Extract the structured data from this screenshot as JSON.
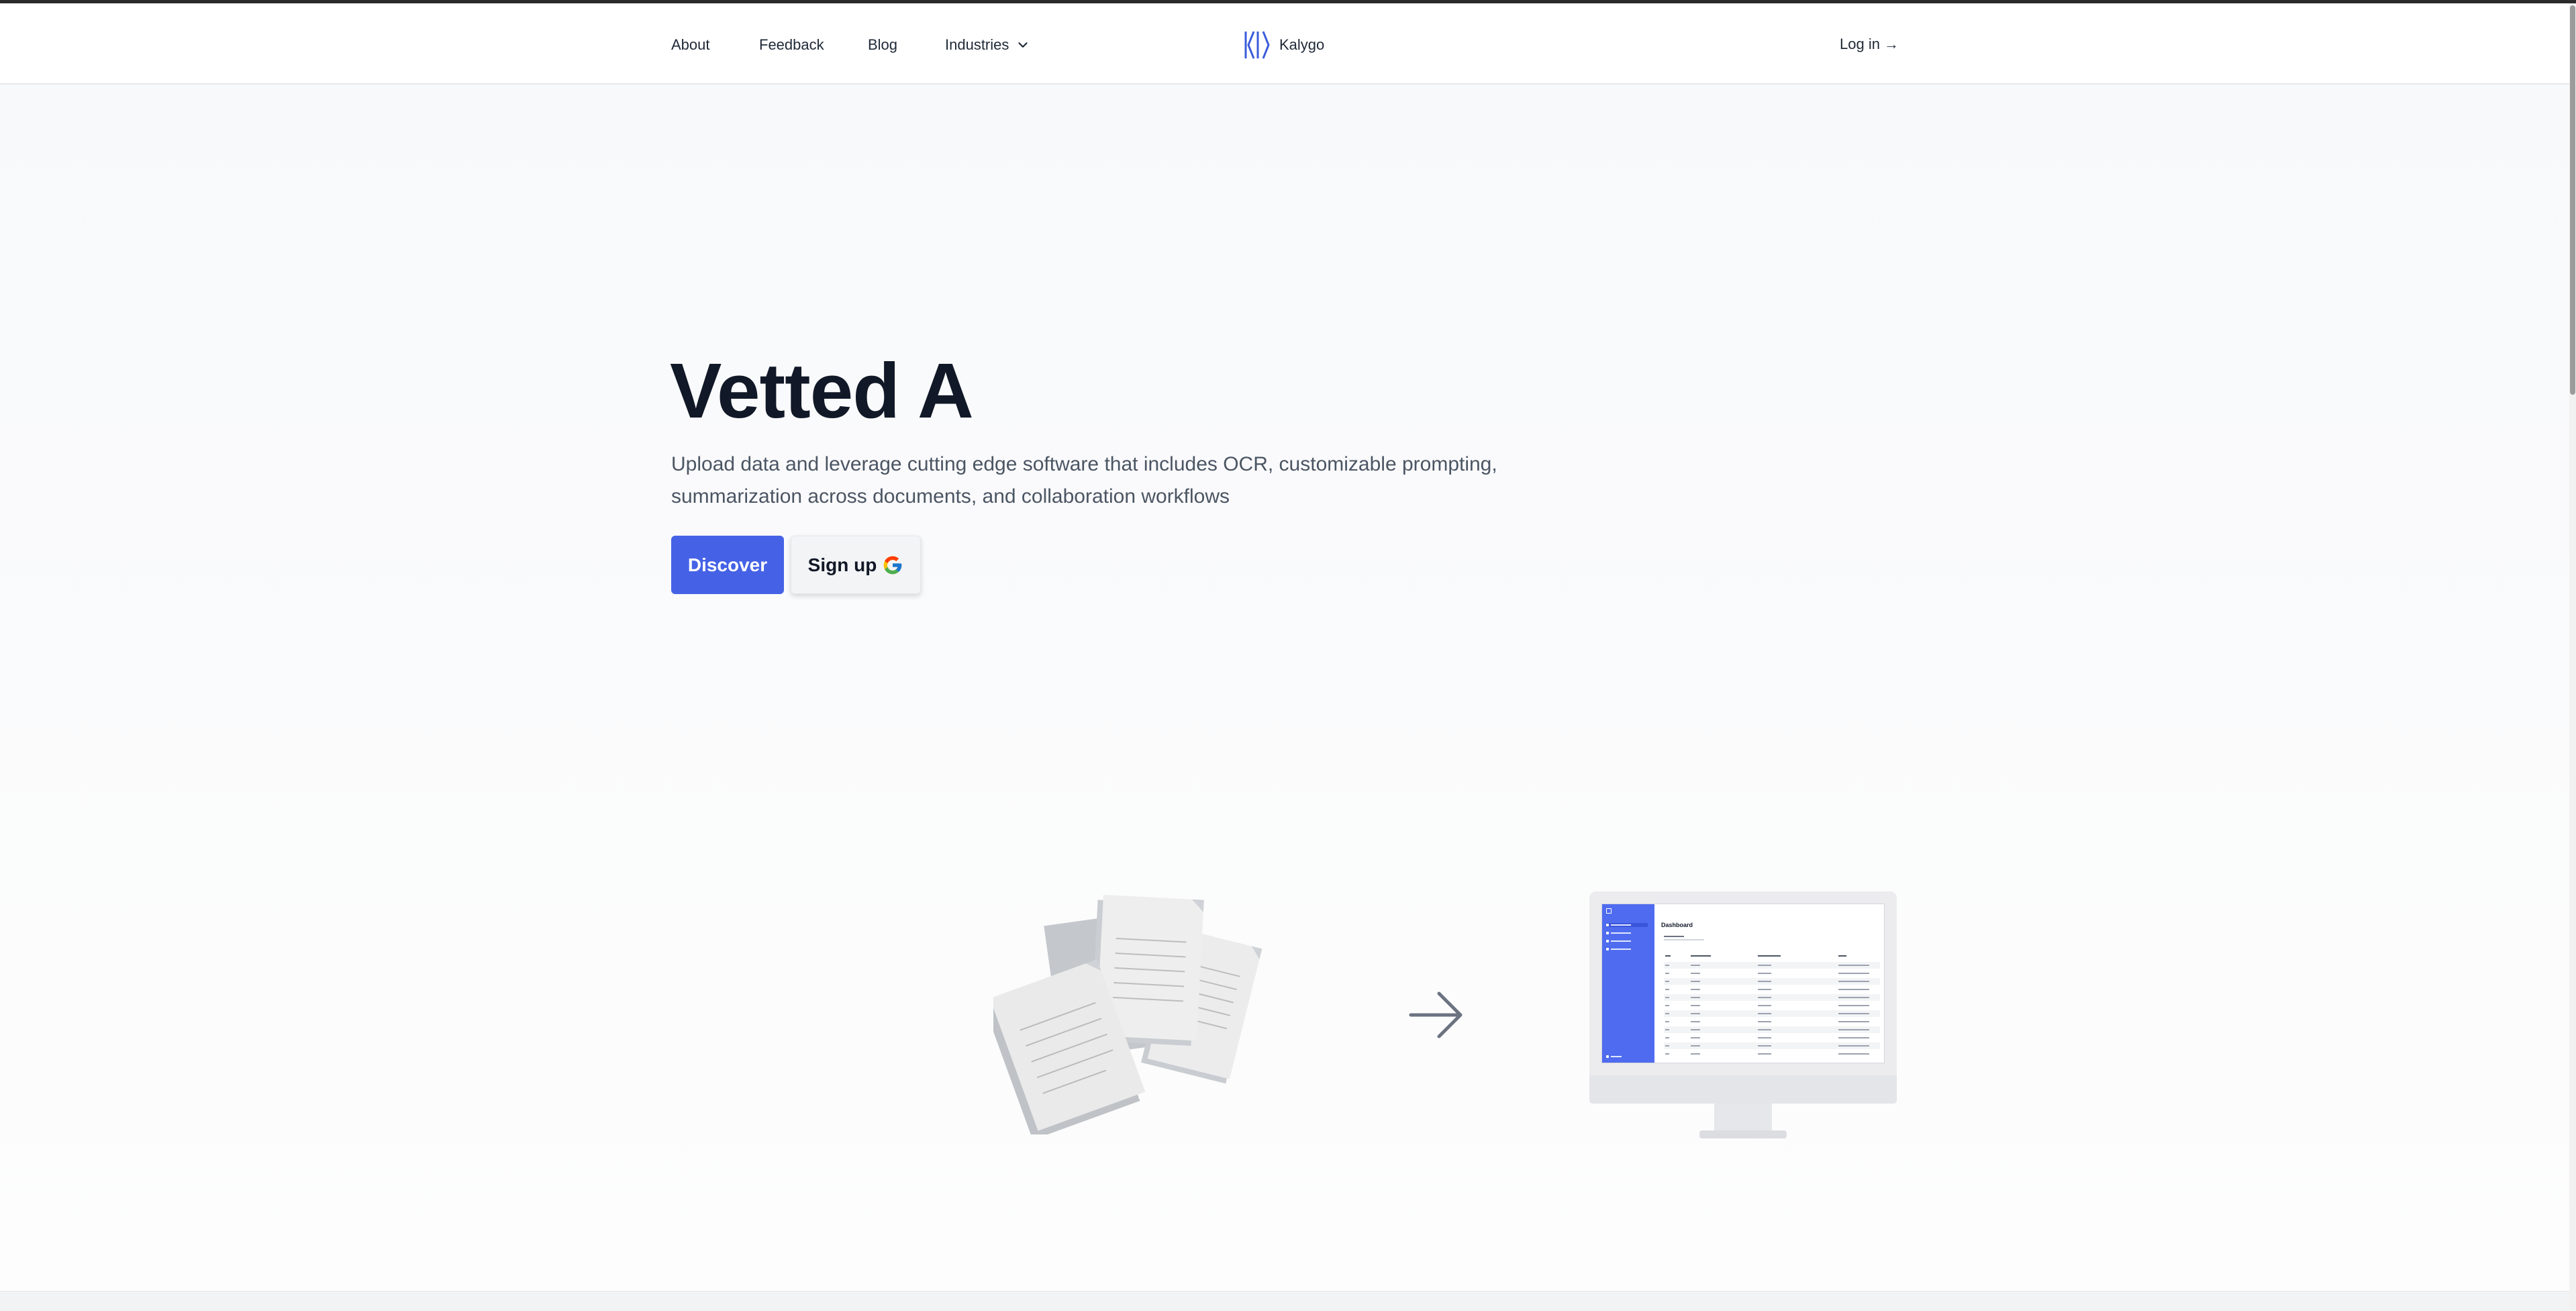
{
  "nav": {
    "items": [
      "About",
      "Feedback",
      "Blog",
      "Industries"
    ],
    "brand": "Kalygo",
    "login_label": "Log in →"
  },
  "hero": {
    "title": "Vetted A",
    "subtitle": "Upload data and leverage cutting edge software that includes OCR, customizable prompting, summarization across documents, and collaboration workflows",
    "discover_label": "Discover",
    "signup_label": "Sign up"
  },
  "illustration": {
    "screen_title": "Dashboard"
  },
  "colors": {
    "accent": "#4562e6",
    "sidebar": "#4f6bef",
    "text": "#111827"
  }
}
